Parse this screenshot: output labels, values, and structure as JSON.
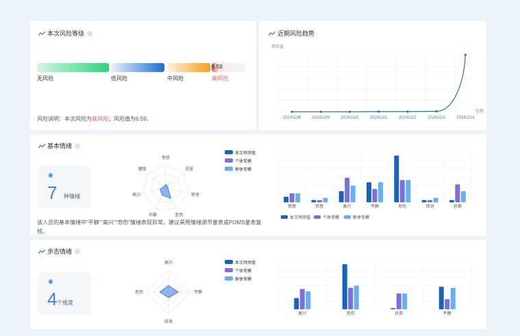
{
  "risk_level": {
    "title": "本次风险等级",
    "segments": [
      {
        "label": "无风险",
        "from": "#d4f5e4",
        "to": "#2fd47a"
      },
      {
        "label": "低风险",
        "from": "#eaf2fc",
        "to": "#1e6fd1"
      },
      {
        "label": "中风险",
        "from": "#fdf1e0",
        "to": "#f5a01e"
      },
      {
        "label": "高风险",
        "from": "#fde8e8",
        "to": "#e55a5a"
      }
    ],
    "value": "6.59",
    "active_index": 3,
    "desc_prefix": "风险说明：本次风险为",
    "desc_level": "高风险",
    "desc_suffix": "；风险值为6.59。"
  },
  "trend": {
    "title": "近期风险趋势",
    "chart_data": {
      "type": "line",
      "ylabel": "风险值",
      "xlabel": "日期",
      "x": [
        "20241108",
        "20241109",
        "20241110",
        "20241111",
        "20241112",
        "20241113",
        "20241114"
      ],
      "values": [
        0,
        0,
        0,
        0.02,
        0.02,
        0.05,
        6.59
      ],
      "ylim": [
        0,
        6.59
      ],
      "grid": true
    }
  },
  "basic": {
    "title": "基本情绪",
    "count": "7",
    "count_unit": "种情绪",
    "legend": [
      "本次预测值",
      "个体常模",
      "群体常模"
    ],
    "colors": [
      "#1565c0",
      "#7c6fd9",
      "#64aff5"
    ],
    "desc": "该人员的基本情绪中“平静”“高兴”“悲伤”情绪表现异常。建议采用情绪调节量表或POMS量表复核。",
    "chart_data": {
      "type": "bar",
      "categories": [
        "愤怒",
        "厌恶",
        "高兴",
        "平静",
        "悲伤",
        "惊讶",
        "恐惧"
      ],
      "series": [
        {
          "name": "本次预测值",
          "values": [
            0.05,
            0.02,
            0.1,
            0.18,
            0.42,
            0.02,
            0.02
          ]
        },
        {
          "name": "个体常模",
          "values": [
            0.08,
            0.02,
            0.22,
            0.12,
            0.2,
            0.02,
            0.16
          ]
        },
        {
          "name": "群体常模",
          "values": [
            0.08,
            0.04,
            0.15,
            0.18,
            0.2,
            0.04,
            0.1
          ]
        }
      ],
      "ylim": [
        0,
        0.45
      ]
    },
    "radar": {
      "labels": [
        "惊恐",
        "厌恶",
        "惊讶",
        "悲伤",
        "平静",
        "高兴",
        "憎恨"
      ],
      "values": [
        0.15,
        0.1,
        0.1,
        0.5,
        0.35,
        0.25,
        0.1
      ]
    }
  },
  "gait": {
    "title": "步态情绪",
    "count": "4",
    "count_unit": "个维度",
    "legend": [
      "本次预测值",
      "个体常模",
      "群体常模"
    ],
    "desc": "",
    "chart_data": {
      "type": "bar",
      "categories": [
        "高兴",
        "悲伤",
        "好奇",
        "平静"
      ],
      "series": [
        {
          "name": "本次预测值",
          "values": [
            0.1,
            0.4,
            0.01,
            0.2
          ]
        },
        {
          "name": "个体常模",
          "values": [
            0.18,
            0.19,
            0.14,
            0.09
          ]
        },
        {
          "name": "群体常模",
          "values": [
            0.16,
            0.21,
            0.14,
            0.19
          ]
        }
      ],
      "ylim": [
        0,
        0.42
      ]
    },
    "radar": {
      "labels": [
        "高兴",
        "平静",
        "好奇",
        "悲伤"
      ],
      "values": [
        0.3,
        0.45,
        0.25,
        0.4
      ]
    }
  }
}
